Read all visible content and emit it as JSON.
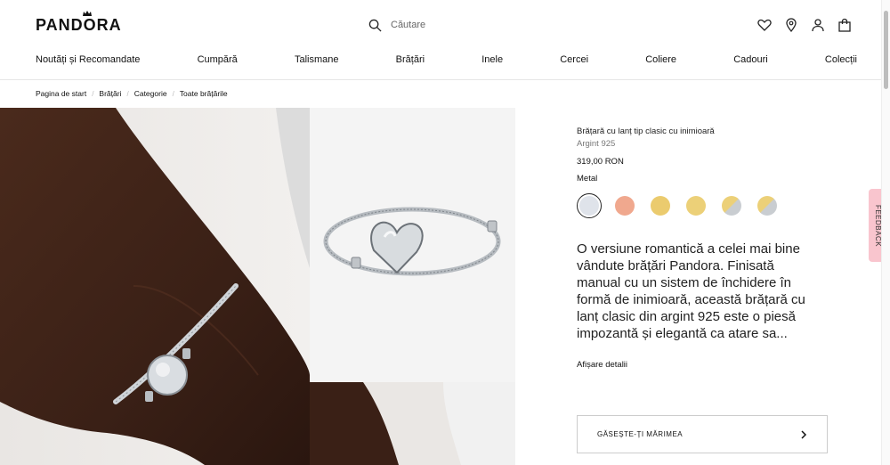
{
  "header": {
    "logo": "PANDORA",
    "search_placeholder": "Căutare",
    "icons": [
      "heart-icon",
      "location-pin-icon",
      "user-icon",
      "bag-icon"
    ]
  },
  "nav": {
    "items": [
      "Noutăți și Recomandate",
      "Cumpără",
      "Talismane",
      "Brățări",
      "Inele",
      "Cercei",
      "Coliere",
      "Cadouri",
      "Colecții"
    ]
  },
  "breadcrumb": [
    "Pagina de start",
    "Brățări",
    "Categorie",
    "Toate brățările"
  ],
  "product": {
    "title": "Brățară cu lanț tip clasic cu inimioară",
    "subtitle": "Argint 925",
    "price": "319,00 RON",
    "metal_label": "Metal",
    "swatches": [
      {
        "color": "#dfe3ea",
        "selected": true
      },
      {
        "color": "#f0a88e",
        "selected": false
      },
      {
        "color": "#ebcb6e",
        "selected": false
      },
      {
        "color": "#ecd078",
        "selected": false
      },
      {
        "color": "#c9c9c9",
        "selected": false
      },
      {
        "color": "#cfcfcf",
        "selected": false
      }
    ],
    "description": "O versiune romantică a celei mai bine vândute brățări Pandora. Finisată manual cu un sistem de închidere în formă de inimioară, această brățară cu lanț clasic din argint 925 este o piesă impozantă și elegantă ca atare sa...",
    "details_link": "Afișare detalii",
    "size_button": "GĂSEȘTE-ȚI MĂRIMEA"
  },
  "feedback_tab": "FEEDBACK"
}
